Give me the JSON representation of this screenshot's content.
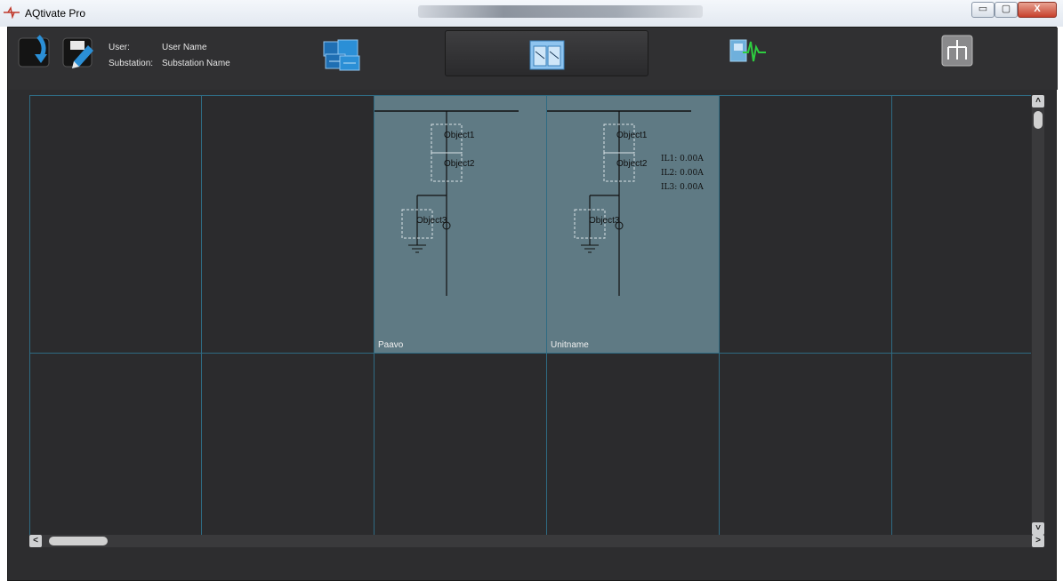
{
  "window": {
    "title": "AQtivate Pro",
    "controls": {
      "minimize": "▭",
      "maximize": "▢",
      "close": "X"
    }
  },
  "toolbar": {
    "icons": [
      "read-device-icon",
      "write-settings-icon",
      "device-settings-icon",
      "mimic-editor-icon",
      "disturbance-recorder-icon",
      "network-topology-icon"
    ],
    "user_label": "User:",
    "user_value": "User Name",
    "substation_label": "Substation:",
    "substation_value": "Substation Name"
  },
  "grid": {
    "units": [
      {
        "name": "Paavo",
        "objects": [
          "Object1",
          "Object2",
          "Object3"
        ]
      },
      {
        "name": "Unitname",
        "objects": [
          "Object1",
          "Object2",
          "Object3"
        ],
        "measurements": [
          "IL1:  0.00A",
          "IL2:  0.00A",
          "IL3:  0.00A"
        ]
      }
    ]
  },
  "scrollbars": {
    "up": "˄",
    "down": "˅",
    "left": "<",
    "right": ">"
  },
  "colors": {
    "background": "#2d2d2f",
    "cell_active": "#5f7a84",
    "grid_line": "#2f6b83"
  }
}
